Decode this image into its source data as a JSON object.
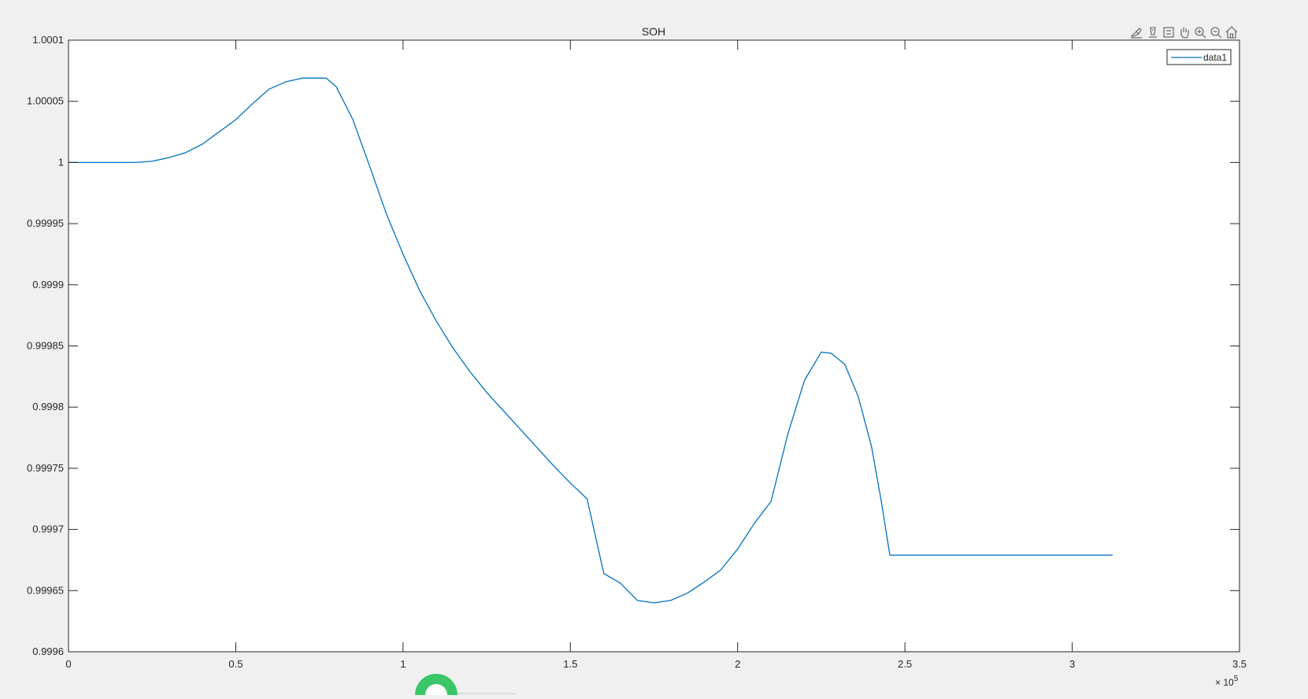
{
  "figure": {
    "background": "#f0f0f0",
    "axes_background": "#ffffff",
    "axis_color": "#262626",
    "line_color": "#0072bd"
  },
  "toolbar": {
    "icons": [
      "brush-icon",
      "data-tips-icon",
      "restore-view-icon",
      "pan-icon",
      "zoom-in-icon",
      "zoom-out-icon",
      "home-icon"
    ]
  },
  "chart_data": {
    "type": "line",
    "title": "SOH",
    "xlabel": "",
    "ylabel": "",
    "xlim": [
      0,
      350000
    ],
    "ylim": [
      0.9996,
      1.0001
    ],
    "x_exponent_label": "× 10",
    "x_exponent_power": "5",
    "xticks": [
      0,
      50000,
      100000,
      150000,
      200000,
      250000,
      300000,
      350000
    ],
    "xtick_labels": [
      "0",
      "0.5",
      "1",
      "1.5",
      "2",
      "2.5",
      "3",
      "3.5"
    ],
    "yticks": [
      0.9996,
      0.99965,
      0.9997,
      0.99975,
      0.9998,
      0.99985,
      0.9999,
      0.99995,
      1,
      1.00005,
      1.0001
    ],
    "ytick_labels": [
      "0.9996",
      "0.99965",
      "0.9997",
      "0.99975",
      "0.9998",
      "0.99985",
      "0.9999",
      "0.99995",
      "1",
      "1.00005",
      "1.0001"
    ],
    "grid": false,
    "legend_position": "top-right",
    "series": [
      {
        "name": "data1",
        "color": "#0072bd",
        "points": [
          [
            0,
            1.0
          ],
          [
            10000,
            1.0
          ],
          [
            20000,
            1.0
          ],
          [
            25000,
            1.000001
          ],
          [
            30000,
            1.000004
          ],
          [
            35000,
            1.000008
          ],
          [
            40000,
            1.000015
          ],
          [
            45000,
            1.000025
          ],
          [
            50000,
            1.000035
          ],
          [
            55000,
            1.000048
          ],
          [
            60000,
            1.00006
          ],
          [
            65000,
            1.000066
          ],
          [
            70000,
            1.000069
          ],
          [
            75000,
            1.000069
          ],
          [
            77000,
            1.000069
          ],
          [
            80000,
            1.000062
          ],
          [
            85000,
            1.000035
          ],
          [
            90000,
            0.999997
          ],
          [
            95000,
            0.999958
          ],
          [
            100000,
            0.999925
          ],
          [
            105000,
            0.999895
          ],
          [
            110000,
            0.99987
          ],
          [
            115000,
            0.999848
          ],
          [
            120000,
            0.999829
          ],
          [
            125000,
            0.999812
          ],
          [
            130000,
            0.999797
          ],
          [
            135000,
            0.999782
          ],
          [
            140000,
            0.999767
          ],
          [
            145000,
            0.999752
          ],
          [
            150000,
            0.999738
          ],
          [
            155000,
            0.999725
          ],
          [
            160000,
            0.999664
          ],
          [
            165000,
            0.999656
          ],
          [
            170000,
            0.999642
          ],
          [
            175000,
            0.99964
          ],
          [
            180000,
            0.999642
          ],
          [
            185000,
            0.999648
          ],
          [
            190000,
            0.999657
          ],
          [
            195000,
            0.999667
          ],
          [
            200000,
            0.999684
          ],
          [
            205000,
            0.999705
          ],
          [
            210000,
            0.999723
          ],
          [
            215000,
            0.999778
          ],
          [
            220000,
            0.999822
          ],
          [
            225000,
            0.999845
          ],
          [
            228000,
            0.999844
          ],
          [
            232000,
            0.999835
          ],
          [
            236000,
            0.999809
          ],
          [
            240000,
            0.999768
          ],
          [
            243000,
            0.999722
          ],
          [
            245500,
            0.999679
          ],
          [
            260000,
            0.999679
          ],
          [
            280000,
            0.999679
          ],
          [
            300000,
            0.999679
          ],
          [
            312000,
            0.999679
          ]
        ]
      }
    ]
  }
}
